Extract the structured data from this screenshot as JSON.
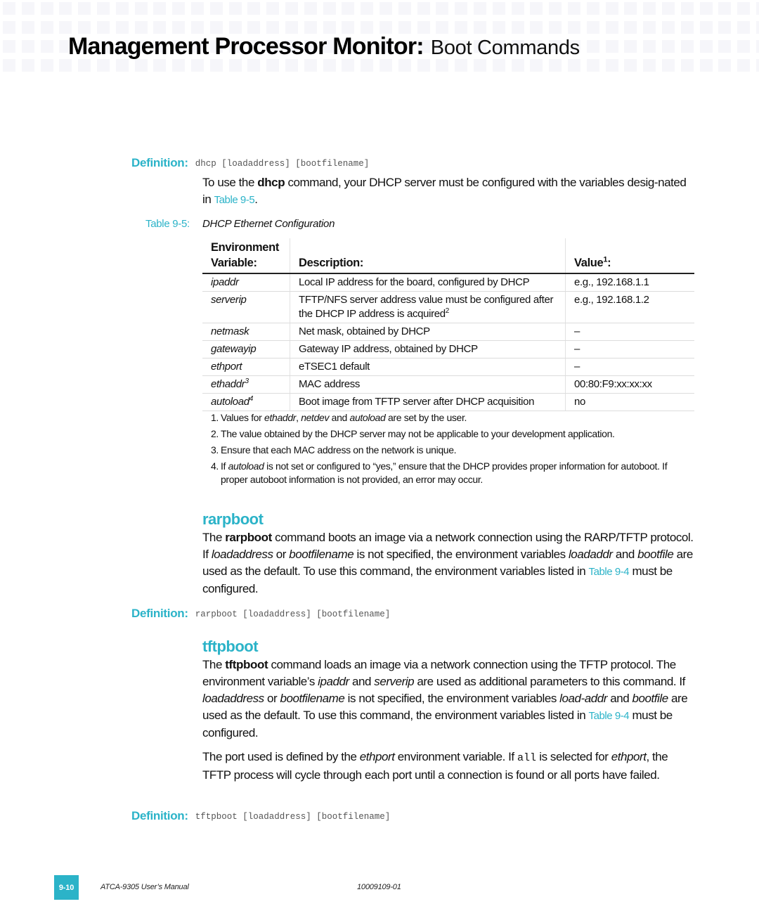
{
  "header": {
    "title": "Management Processor Monitor:",
    "subtitle": "Boot Commands"
  },
  "colors": {
    "accent": "#2bb3c8",
    "grid_square": "#f6f6fa"
  },
  "definition_label": "Definition:",
  "dhcp": {
    "definition": "dhcp [loadaddress] [bootfilename]",
    "intro": {
      "pre": "To use the ",
      "cmd": "dhcp",
      "post": " command, your DHCP server must be configured with the variables desig-nated in ",
      "link": "Table 9-5",
      "end": "."
    }
  },
  "table": {
    "number": "Table 9-5:",
    "title": "DHCP Ethernet Configuration",
    "headers": {
      "variable": "Environment Variable:",
      "description": "Description:",
      "value": "Value",
      "value_sup": "1",
      "value_suffix": ":"
    },
    "rows": [
      {
        "variable": "ipaddr",
        "sup": "",
        "description": "Local IP address for the board, configured by DHCP",
        "desc_sup": "",
        "value": "e.g., 192.168.1.1"
      },
      {
        "variable": "serverip",
        "sup": "",
        "description": "TFTP/NFS server address value must be configured after the DHCP IP address is acquired",
        "desc_sup": "2",
        "value": "e.g., 192.168.1.2"
      },
      {
        "variable": "netmask",
        "sup": "",
        "description": "Net mask, obtained by DHCP",
        "desc_sup": "",
        "value": "–"
      },
      {
        "variable": "gatewayip",
        "sup": "",
        "description": "Gateway IP address, obtained by DHCP",
        "desc_sup": "",
        "value": "–"
      },
      {
        "variable": "ethport",
        "sup": "",
        "description": "eTSEC1 default",
        "desc_sup": "",
        "value": "–"
      },
      {
        "variable": "ethaddr",
        "sup": "3",
        "description": "MAC address",
        "desc_sup": "",
        "value": "00:80:F9:xx:xx:xx"
      },
      {
        "variable": "autoload",
        "sup": "4",
        "description": "Boot image from TFTP server after DHCP acquisition",
        "desc_sup": "",
        "value": "no"
      }
    ],
    "notes": [
      {
        "num": "1.",
        "parts": [
          [
            "Values for ",
            ""
          ],
          [
            "ethaddr",
            "i"
          ],
          [
            ", ",
            ""
          ],
          [
            "netdev",
            "i"
          ],
          [
            " and ",
            ""
          ],
          [
            "autoload",
            "i"
          ],
          [
            " are set by the user.",
            ""
          ]
        ]
      },
      {
        "num": "2.",
        "parts": [
          [
            "The value obtained by the DHCP server may not be applicable to your development application.",
            ""
          ]
        ]
      },
      {
        "num": "3.",
        "parts": [
          [
            "Ensure that each MAC address on the network is unique.",
            ""
          ]
        ]
      },
      {
        "num": "4.",
        "parts": [
          [
            "If ",
            ""
          ],
          [
            "autoload",
            "i"
          ],
          [
            " is not set or configured to “yes,” ensure that the DHCP provides proper information for autoboot. If proper autoboot information is not provided, an error may occur.",
            ""
          ]
        ]
      }
    ]
  },
  "rarpboot": {
    "title": "rarpboot",
    "body": [
      [
        "The ",
        ""
      ],
      [
        "rarpboot",
        "b"
      ],
      [
        " command boots an image via a network connection using the RARP/TFTP protocol. If ",
        ""
      ],
      [
        "loadaddress",
        "i"
      ],
      [
        " or ",
        ""
      ],
      [
        "bootfilename",
        "i"
      ],
      [
        " is not specified, the environment variables ",
        ""
      ],
      [
        "loadaddr",
        "i"
      ],
      [
        " and ",
        ""
      ],
      [
        "bootfile",
        "i"
      ],
      [
        " are used as the default. To use this command, the environment variables listed in ",
        ""
      ],
      [
        "Table 9-4",
        "link"
      ],
      [
        " must be configured.",
        ""
      ]
    ],
    "definition": "rarpboot [loadaddress] [bootfilename]"
  },
  "tftpboot": {
    "title": "tftpboot",
    "body": [
      [
        "The ",
        ""
      ],
      [
        "tftpboot",
        "b"
      ],
      [
        " command loads an image via a network connection using the TFTP protocol. The environment variable’s ",
        ""
      ],
      [
        "ipaddr",
        "i"
      ],
      [
        " and ",
        ""
      ],
      [
        "serverip",
        "i"
      ],
      [
        " are used as additional parameters to this command. If ",
        ""
      ],
      [
        "loadaddress",
        "i"
      ],
      [
        " or ",
        ""
      ],
      [
        "bootfilename",
        "i"
      ],
      [
        " is not specified, the environment variables ",
        ""
      ],
      [
        "load-addr",
        "i"
      ],
      [
        " and ",
        ""
      ],
      [
        "bootfile",
        "i"
      ],
      [
        " are used as the default. To use this command, the environment variables listed in ",
        ""
      ],
      [
        "Table 9-4",
        "link"
      ],
      [
        " must be configured.",
        ""
      ]
    ],
    "body2": [
      [
        "The port used is defined by the ",
        ""
      ],
      [
        "ethport",
        "i"
      ],
      [
        " environment variable. If ",
        ""
      ],
      [
        "all",
        "code"
      ],
      [
        " is selected for ",
        ""
      ],
      [
        "ethport",
        "i"
      ],
      [
        ", the TFTP process will cycle through each port until a connection is found or all ports have failed.",
        ""
      ]
    ],
    "definition": "tftpboot [loadaddress] [bootfilename]"
  },
  "footer": {
    "page_number": "9-10",
    "manual": "ATCA-9305 User’s Manual",
    "doc_number": "10009109-01"
  }
}
